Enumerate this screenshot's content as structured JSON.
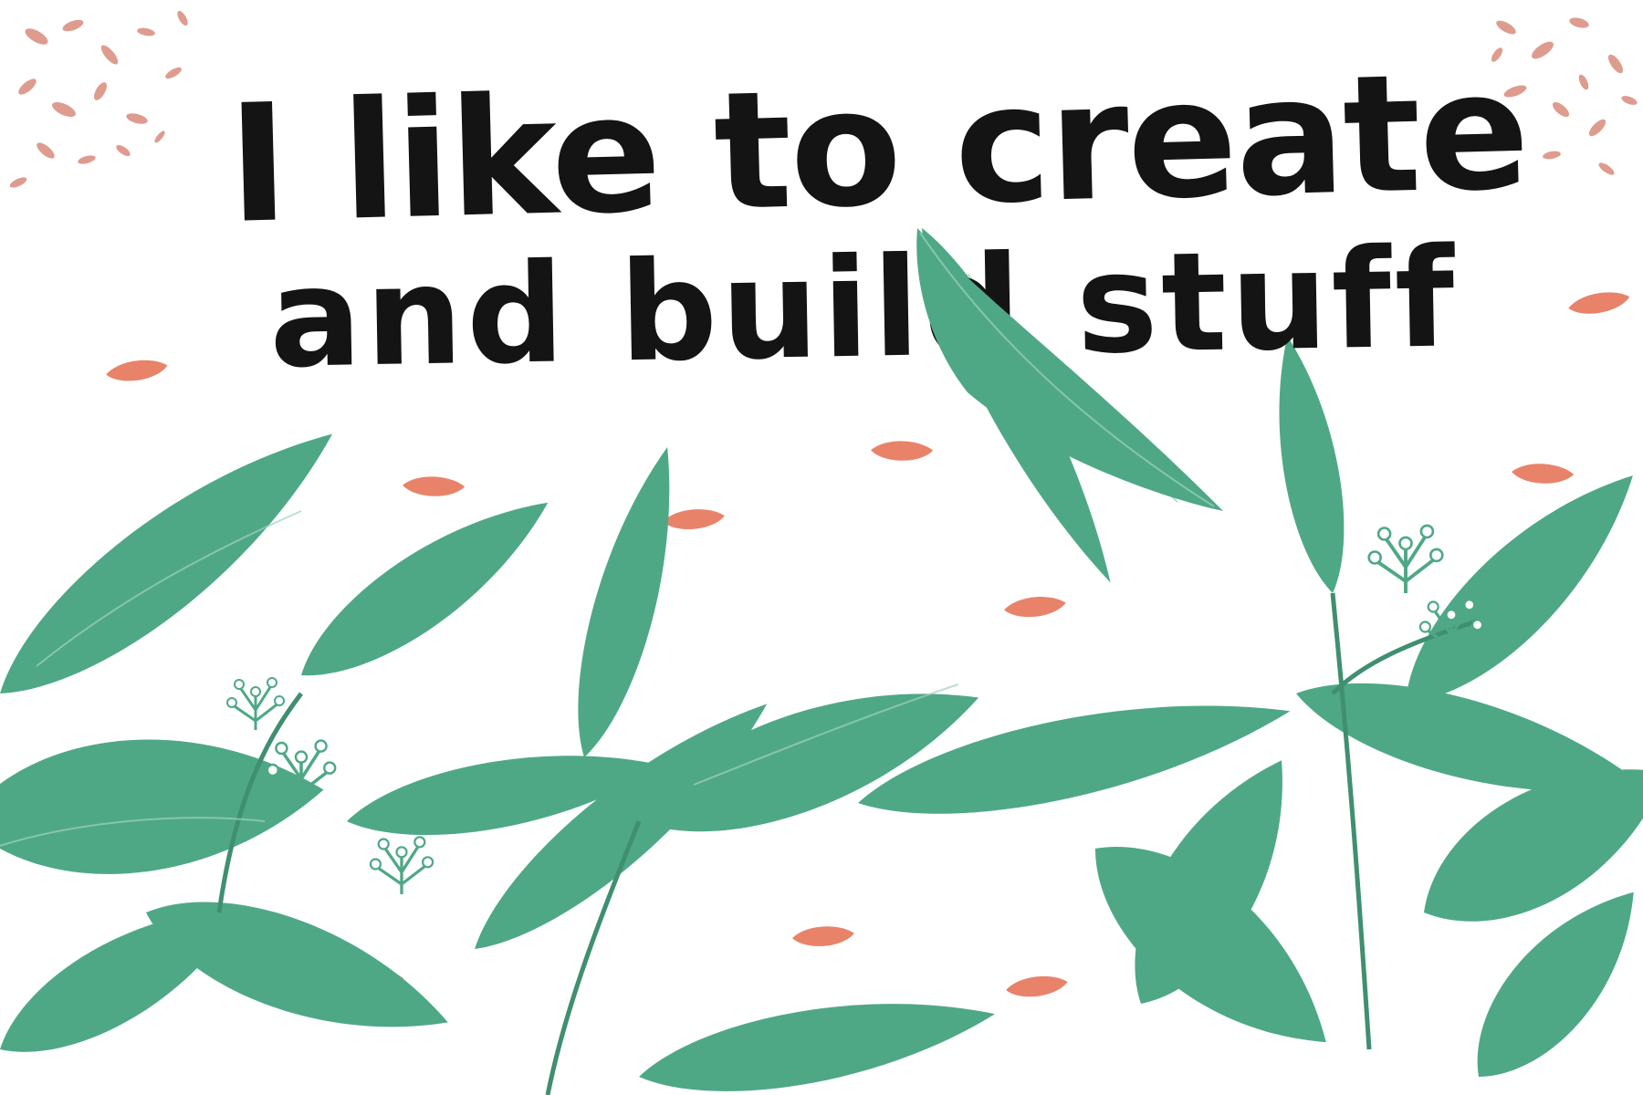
{
  "headline": {
    "line1": "I like to create",
    "line2": "and build stuff"
  },
  "colors": {
    "ink": "#141414",
    "leaf_green": "#4ea886",
    "leaf_green_dark": "#3f8f70",
    "leaf_green_light": "#9fd2bd",
    "petal_coral": "#e8836a",
    "confetti_pink": "#d98b7c",
    "background": "#ffffff"
  },
  "decorations": {
    "corner_clusters": [
      "top-left",
      "top-right"
    ],
    "petal_count": 13,
    "foliage": "green leafy branches with white bud clusters"
  }
}
